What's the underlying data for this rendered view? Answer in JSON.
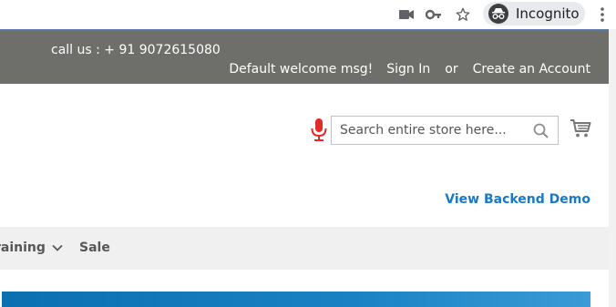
{
  "browser": {
    "incognito_label": "Incognito",
    "icons": [
      "camera-icon",
      "key-icon",
      "star-icon",
      "incognito-icon",
      "kebab-menu-icon"
    ]
  },
  "header": {
    "call_us": "call us : + 91 9072615080",
    "welcome": "Default welcome msg!",
    "sign_in": "Sign In",
    "or": "or",
    "create_account": "Create an Account",
    "background_color": "#6e6e6b"
  },
  "search": {
    "placeholder": "Search entire store here..."
  },
  "backend_demo_link": "View Backend Demo",
  "nav": {
    "items": [
      {
        "label": "raining",
        "has_dropdown": true
      },
      {
        "label": "Sale",
        "has_dropdown": false
      }
    ]
  },
  "colors": {
    "link_blue": "#1979c3",
    "mic_red": "#e02b27",
    "nav_bg": "#f0f0f0"
  }
}
